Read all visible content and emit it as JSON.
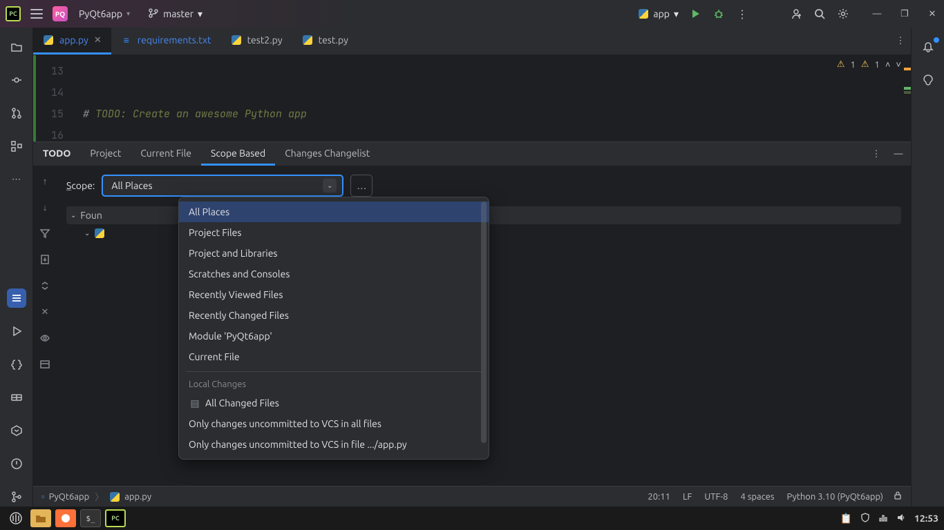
{
  "titlebar": {
    "project_badge": "PQ",
    "project_name": "PyQt6app",
    "branch_name": "master",
    "run_config": "app"
  },
  "tabs": [
    {
      "label": "app.py",
      "active": true,
      "closable": true
    },
    {
      "label": "requirements.txt",
      "active": false,
      "closable": false,
      "blue": true
    },
    {
      "label": "test2.py",
      "active": false,
      "closable": false
    },
    {
      "label": "test.py",
      "active": false,
      "closable": false
    }
  ],
  "editor": {
    "line_start": 13,
    "lines": [
      "",
      "",
      "# TODO: Create an awesome Python app",
      ""
    ],
    "warnings1": "1",
    "warnings2": "1"
  },
  "todo_window": {
    "title": "TODO",
    "tabs": [
      "Project",
      "Current File",
      "Scope Based",
      "Changes Changelist"
    ],
    "active_tab": "Scope Based",
    "scope_label_pre": "S",
    "scope_label_post": "cope:",
    "scope_value": "All Places",
    "tree_found_label": "Foun"
  },
  "scope_dropdown": {
    "main": [
      "All Places",
      "Project Files",
      "Project and Libraries",
      "Scratches and Consoles",
      "Recently Viewed Files",
      "Recently Changed Files",
      "Module 'PyQt6app'",
      "Current File"
    ],
    "section_header": "Local Changes",
    "secondary": [
      {
        "icon": true,
        "label": "All Changed Files"
      },
      {
        "icon": false,
        "label": "Only changes uncommitted to VCS in all files"
      },
      {
        "icon": false,
        "label": "Only changes uncommitted to VCS in file .../app.py"
      }
    ],
    "selected": "All Places"
  },
  "navbar": {
    "crumb1": "PyQt6app",
    "crumb2": "app.py"
  },
  "statusbar": {
    "pos": "20:11",
    "line_end": "LF",
    "encoding": "UTF-8",
    "indent": "4 spaces",
    "interpreter": "Python 3.10 (PyQt6app)"
  },
  "taskbar": {
    "clock": "12:53"
  }
}
